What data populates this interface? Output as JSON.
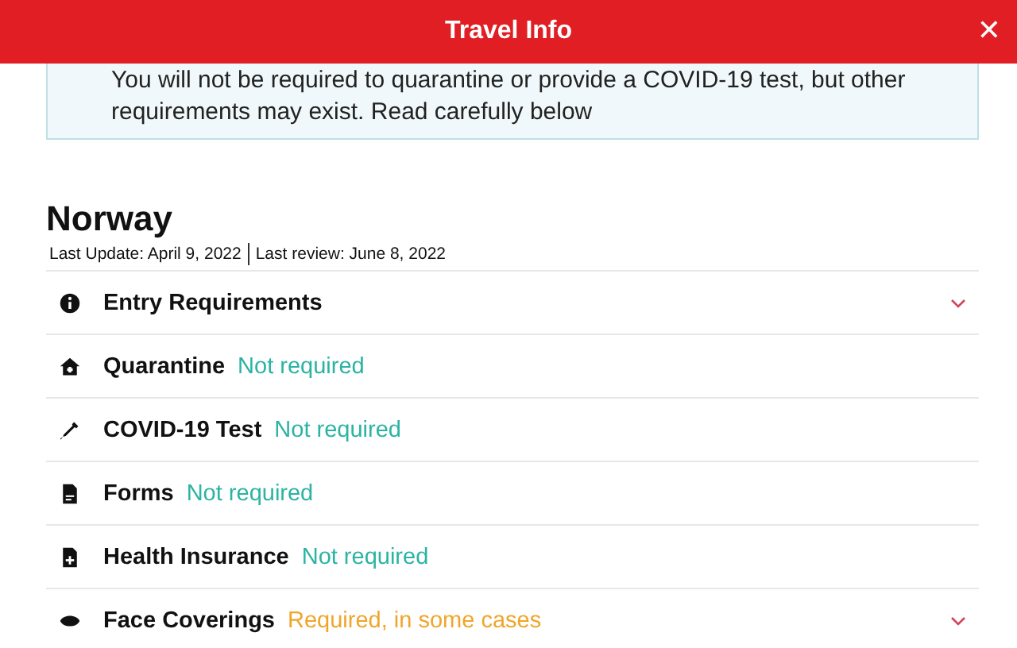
{
  "header": {
    "title": "Travel Info",
    "close": "✕"
  },
  "notice": {
    "text": "You will not be required to quarantine or provide a COVID-19 test, but other requirements may exist. Read carefully below"
  },
  "country": {
    "name": "Norway",
    "last_update": "Last Update: April 9, 2022",
    "last_review": "Last review: June 8, 2022"
  },
  "rows": [
    {
      "kind": "info",
      "label": "Entry Requirements",
      "expandable": true
    },
    {
      "kind": "house",
      "label": "Quarantine",
      "status": "Not required",
      "color": "#2bb3a3",
      "expandable": false
    },
    {
      "kind": "syringe",
      "label": "COVID-19 Test",
      "status": "Not required",
      "color": "#2bb3a3",
      "expandable": false
    },
    {
      "kind": "document",
      "label": "Forms",
      "status": "Not required",
      "color": "#2bb3a3",
      "expandable": false
    },
    {
      "kind": "insurance",
      "label": "Health Insurance",
      "status": "Not required",
      "color": "#2bb3a3",
      "expandable": false
    },
    {
      "kind": "mask",
      "label": "Face Coverings",
      "status": "Required, in some cases",
      "color": "#f0a52a",
      "expandable": true
    }
  ]
}
